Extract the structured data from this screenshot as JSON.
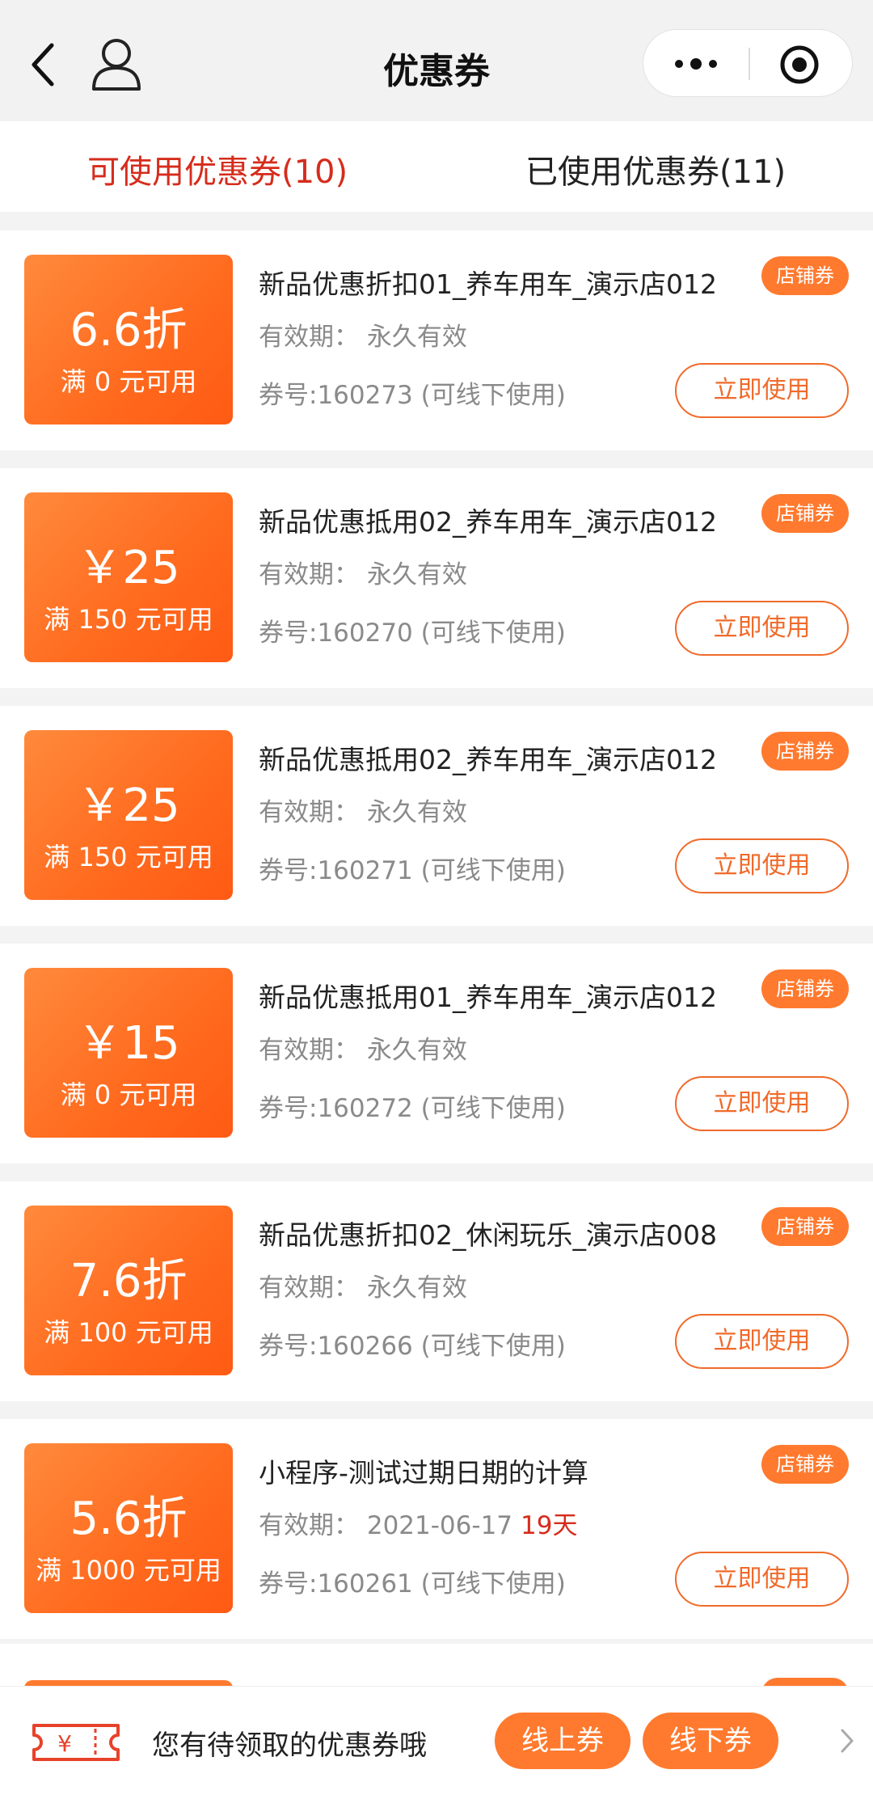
{
  "header": {
    "title": "优惠券"
  },
  "tabs": [
    {
      "label": "可使用优惠券(10)",
      "active": true
    },
    {
      "label": "已使用优惠券(11)",
      "active": false
    }
  ],
  "coupons": [
    {
      "value": "6.6折",
      "condition": "满 0 元可用",
      "title": "新品优惠折扣01_养车用车_演示店012",
      "validity": "有效期：  永久有效",
      "days": "",
      "code": "券号:160273 (可线下使用)",
      "tag": "店铺券",
      "button": "立即使用"
    },
    {
      "value": "￥25",
      "condition": "满 150 元可用",
      "title": "新品优惠抵用02_养车用车_演示店012",
      "validity": "有效期：  永久有效",
      "days": "",
      "code": "券号:160270 (可线下使用)",
      "tag": "店铺券",
      "button": "立即使用"
    },
    {
      "value": "￥25",
      "condition": "满 150 元可用",
      "title": "新品优惠抵用02_养车用车_演示店012",
      "validity": "有效期：  永久有效",
      "days": "",
      "code": "券号:160271 (可线下使用)",
      "tag": "店铺券",
      "button": "立即使用"
    },
    {
      "value": "￥15",
      "condition": "满 0 元可用",
      "title": "新品优惠抵用01_养车用车_演示店012",
      "validity": "有效期：  永久有效",
      "days": "",
      "code": "券号:160272 (可线下使用)",
      "tag": "店铺券",
      "button": "立即使用"
    },
    {
      "value": "7.6折",
      "condition": "满 100 元可用",
      "title": "新品优惠折扣02_休闲玩乐_演示店008",
      "validity": "有效期：  永久有效",
      "days": "",
      "code": "券号:160266 (可线下使用)",
      "tag": "店铺券",
      "button": "立即使用"
    },
    {
      "value": "5.6折",
      "condition": "满 1000 元可用",
      "title": "小程序-测试过期日期的计算",
      "validity": "有效期：  2021-06-17",
      "days": "19天",
      "code": "券号:160261 (可线下使用)",
      "tag": "店铺券",
      "button": "立即使用"
    }
  ],
  "bottom_bar": {
    "text": "您有待领取的优惠券哦",
    "online_label": "线上券",
    "offline_label": "线下券"
  },
  "colors": {
    "accent": "#ff7a2e",
    "active_tab": "#d62c1c",
    "button_border": "#f06a2a"
  }
}
